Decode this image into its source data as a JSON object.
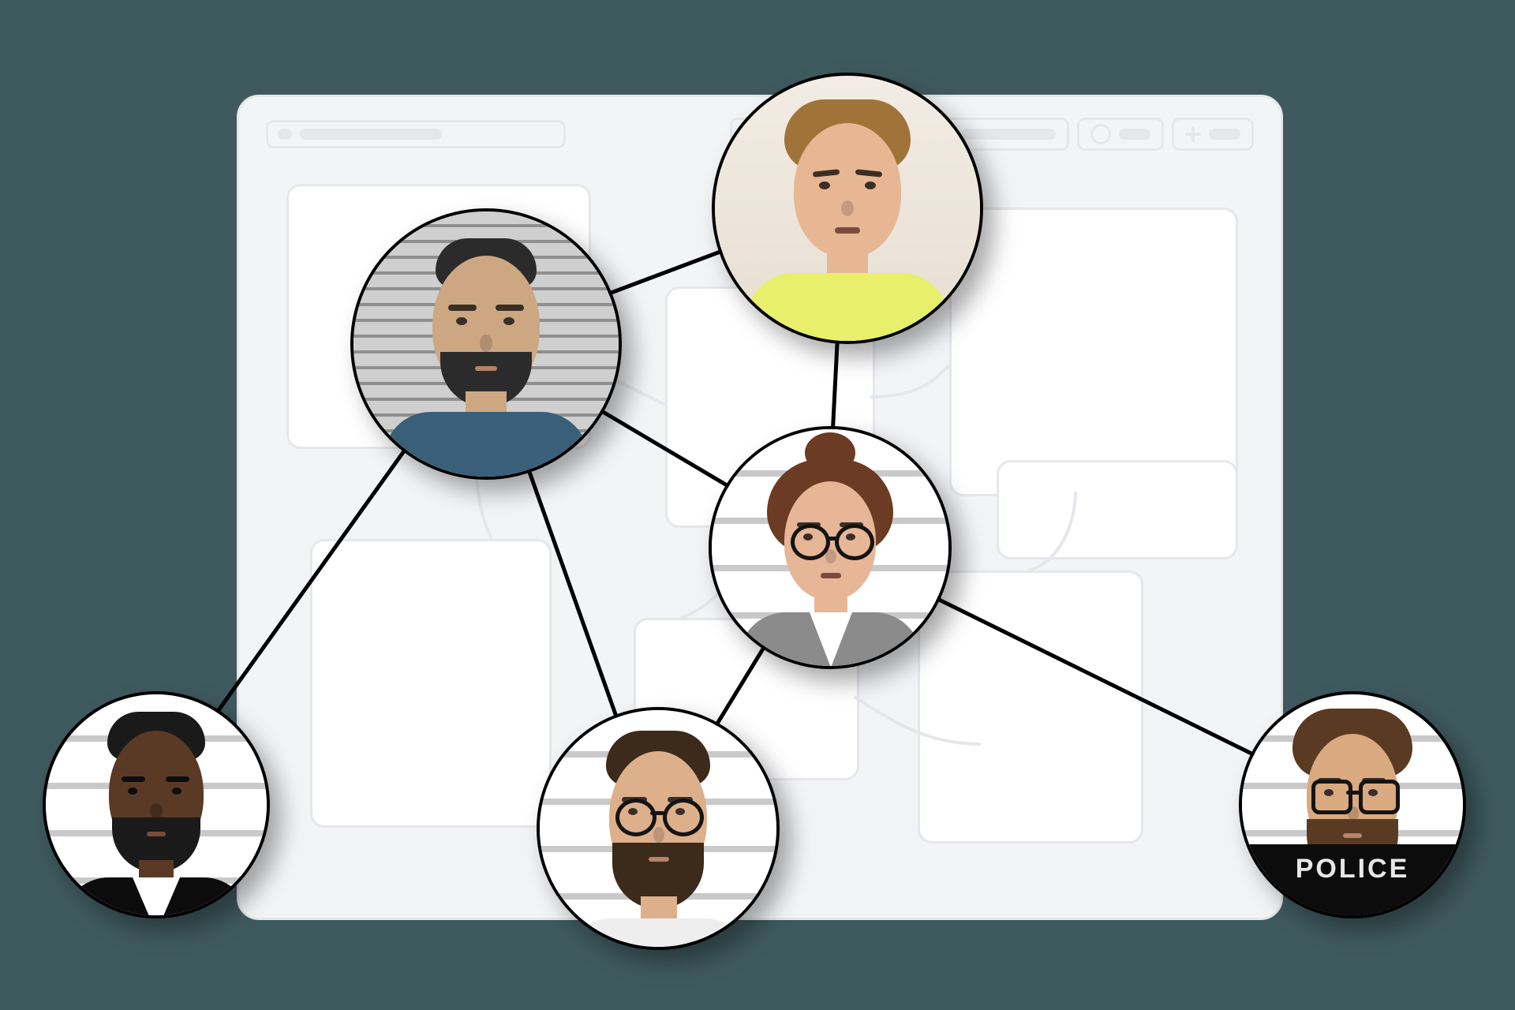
{
  "diagram": {
    "description": "Suspect relationship network overlaid on a wireframe application window",
    "police_tag_label": "POLICE",
    "nodes": [
      {
        "id": "suspect-top-right",
        "role": "suspect",
        "position": "top-right"
      },
      {
        "id": "suspect-upper-center",
        "role": "suspect",
        "position": "upper-center"
      },
      {
        "id": "suspect-mid-right",
        "role": "suspect",
        "position": "mid-right"
      },
      {
        "id": "suspect-bottom-center",
        "role": "suspect",
        "position": "bottom-center"
      },
      {
        "id": "suspect-bottom-left",
        "role": "suspect",
        "position": "bottom-left"
      },
      {
        "id": "suspect-bottom-right",
        "role": "suspect",
        "position": "bottom-right",
        "tag": "POLICE"
      }
    ],
    "edges": [
      [
        "suspect-upper-center",
        "suspect-top-right"
      ],
      [
        "suspect-upper-center",
        "suspect-mid-right"
      ],
      [
        "suspect-upper-center",
        "suspect-bottom-center"
      ],
      [
        "suspect-upper-center",
        "suspect-bottom-left"
      ],
      [
        "suspect-mid-right",
        "suspect-top-right"
      ],
      [
        "suspect-mid-right",
        "suspect-bottom-center"
      ],
      [
        "suspect-mid-right",
        "suspect-bottom-right"
      ]
    ]
  }
}
